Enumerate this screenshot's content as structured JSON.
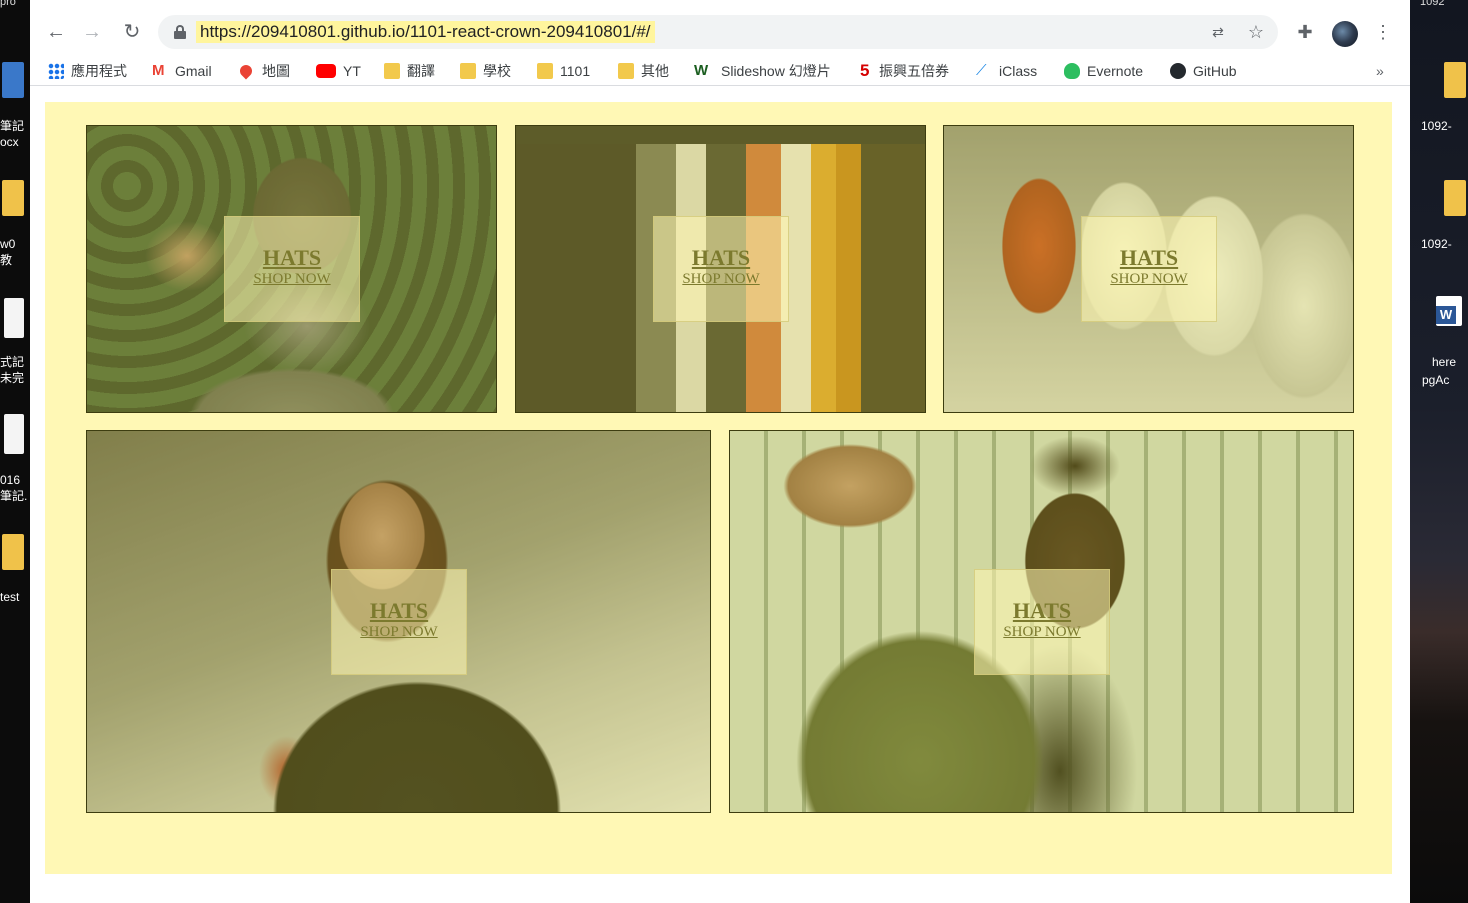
{
  "browser": {
    "url": "https://209410801.github.io/1101-react-crown-209410801/#/"
  },
  "bookmarks": [
    {
      "label": "應用程式"
    },
    {
      "label": "Gmail"
    },
    {
      "label": "地圖"
    },
    {
      "label": "YT"
    },
    {
      "label": "翻譯"
    },
    {
      "label": "學校"
    },
    {
      "label": "1101"
    },
    {
      "label": "其他"
    },
    {
      "label": "Slideshow 幻燈片"
    },
    {
      "label": "振興五倍券"
    },
    {
      "label": "iClass"
    },
    {
      "label": "Evernote"
    },
    {
      "label": "GitHub"
    }
  ],
  "bookmarks_more": "»",
  "desktop": {
    "top_left": "pro",
    "top_right": "1092",
    "left_labels": [
      "筆記",
      "ocx",
      "w0",
      "教",
      "式記",
      "未完",
      "016",
      "筆記.",
      "test"
    ],
    "right_labels": [
      "1092-",
      "1092-",
      "here",
      "pgAc"
    ]
  },
  "menu": {
    "sections": [
      {
        "title": "HATS",
        "subtitle": "SHOP NOW"
      },
      {
        "title": "HATS",
        "subtitle": "SHOP NOW"
      },
      {
        "title": "HATS",
        "subtitle": "SHOP NOW"
      },
      {
        "title": "HATS",
        "subtitle": "SHOP NOW"
      },
      {
        "title": "HATS",
        "subtitle": "SHOP NOW"
      }
    ]
  },
  "colors": {
    "page_background": "#fff8b5",
    "url_highlight": "#fff59d",
    "overlay_tint": "#e1de3c"
  }
}
